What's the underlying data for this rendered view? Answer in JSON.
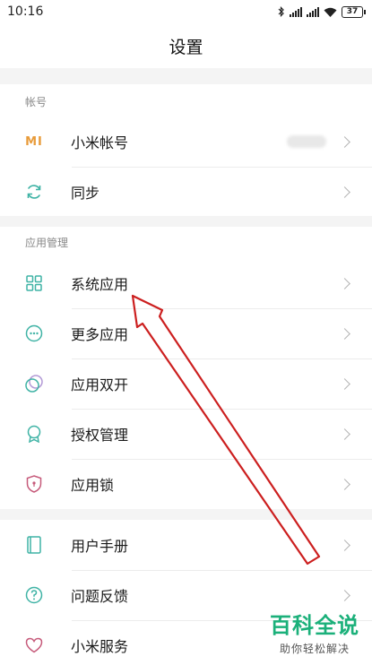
{
  "status_bar": {
    "time": "10:16",
    "battery": "37",
    "icons": [
      "bluetooth-icon",
      "signal-icon",
      "signal-icon",
      "wifi-icon",
      "battery-icon"
    ]
  },
  "header": {
    "title": "设置"
  },
  "sections": [
    {
      "header": "帐号",
      "items": [
        {
          "label": "小米帐号",
          "icon": "mi-logo-icon",
          "has_blurred_value": true
        },
        {
          "label": "同步",
          "icon": "sync-icon"
        }
      ]
    },
    {
      "header": "应用管理",
      "items": [
        {
          "label": "系统应用",
          "icon": "grid-apps-icon"
        },
        {
          "label": "更多应用",
          "icon": "more-apps-icon"
        },
        {
          "label": "应用双开",
          "icon": "dual-apps-icon"
        },
        {
          "label": "授权管理",
          "icon": "permission-badge-icon"
        },
        {
          "label": "应用锁",
          "icon": "app-lock-shield-icon"
        }
      ]
    },
    {
      "header": "",
      "items": [
        {
          "label": "用户手册",
          "icon": "user-manual-icon"
        },
        {
          "label": "问题反馈",
          "icon": "feedback-question-icon"
        },
        {
          "label": "小米服务",
          "icon": "mi-service-heart-icon"
        }
      ]
    }
  ],
  "mi_logo_text": "MI",
  "watermark": {
    "title": "百科全说",
    "subtitle": "助你轻松解决"
  },
  "colors": {
    "accent_teal": "#3fb3a5",
    "mi_orange": "#e89b3a",
    "lock_pink": "#c65a7a",
    "annotation_red": "#cc1f1f",
    "watermark_green": "#1bb07a"
  }
}
